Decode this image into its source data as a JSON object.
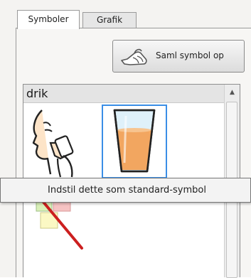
{
  "tabs": [
    {
      "label": "Symboler",
      "active": true
    },
    {
      "label": "Grafik",
      "active": false
    }
  ],
  "toolbar": {
    "collect_button_label": "Saml symbol op",
    "collect_button_icon": "hand-grab-icon"
  },
  "symbol_list": {
    "category": "drik",
    "items": [
      {
        "icon": "smell-symbol-icon",
        "selected": false
      },
      {
        "icon": "glass-of-juice-icon",
        "selected": true
      },
      {
        "icon": "no-symbol-icon",
        "selected": false
      }
    ],
    "scroll_up_icon": "scroll-up-arrow-icon"
  },
  "context_menu": {
    "item_label": "Indstil dette som standard-symbol"
  },
  "colors": {
    "selection": "#3a8ee6",
    "juice": "#f2a660",
    "strike": "#cc1f1f"
  }
}
